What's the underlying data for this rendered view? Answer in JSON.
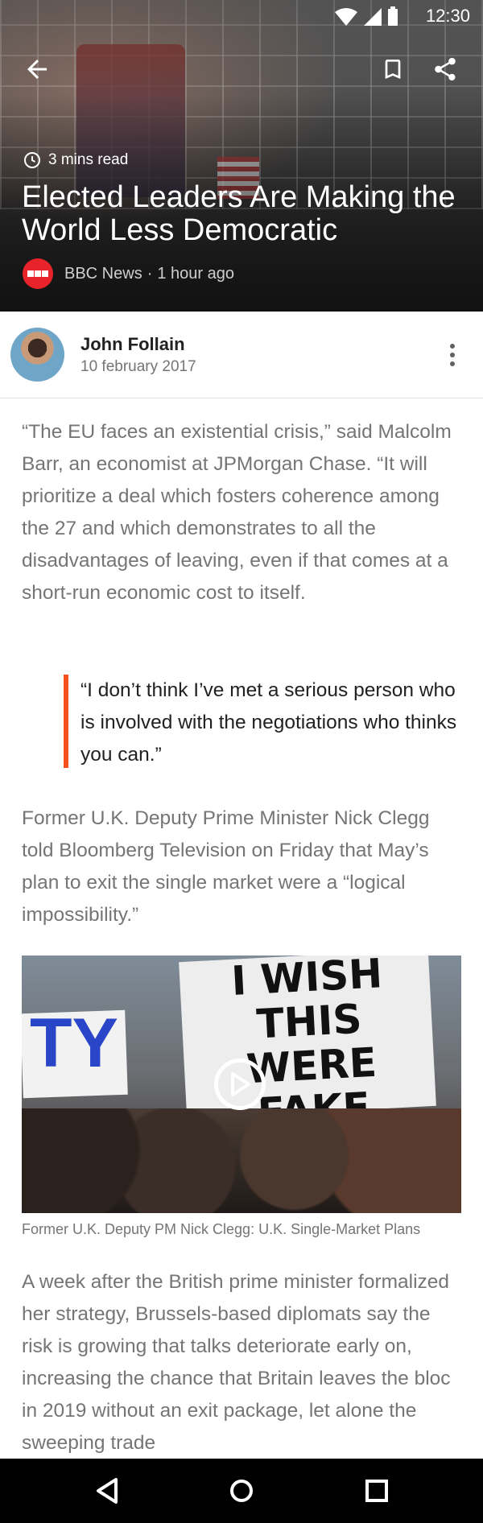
{
  "status_bar": {
    "time": "12:30"
  },
  "article": {
    "read_time": "3 mins read",
    "title": "Elected Leaders Are Making the World Less Democratic",
    "source": {
      "name": "BBC News",
      "separator": "·",
      "time_ago": "1 hour ago"
    }
  },
  "author": {
    "name": "John Follain",
    "date": "10 february 2017"
  },
  "body": {
    "paragraph_1": "“The EU faces an existential crisis,” said Malcolm Barr, an economist at JPMorgan Chase. “It will prioritize a deal which fosters coherence among the 27 and which demonstrates to all the disadvantages of leaving, even if that comes at a short-run economic cost to itself.",
    "quote": "“I don’t think I’ve met a serious person who is involved with the negotiations who thinks you can.”",
    "paragraph_2": "Former U.K. Deputy Prime Minister Nick Clegg told Bloomberg Television on Friday that May’s plan to exit the single market were a “logical impossibility.”",
    "video": {
      "sign_text": "I WISH THIS WERE FAKE NEWS",
      "left_sign_text": "TY",
      "caption": "Former U.K. Deputy PM Nick Clegg: U.K. Single-Market Plans"
    },
    "paragraph_3": "A week after the British prime minister formalized her strategy, Brussels-based diplomats say the risk is growing that talks deteriorate early on, increasing the chance that Britain leaves the bloc in 2019 without an exit package, let alone the sweeping trade"
  },
  "colors": {
    "accent": "#f4511e",
    "bbc_red": "#e8232a",
    "body_text": "#757575",
    "nav_bg": "#000000"
  },
  "icons": [
    "wifi-icon",
    "cell-signal-icon",
    "battery-icon",
    "back-arrow-icon",
    "bookmark-icon",
    "share-icon",
    "clock-icon",
    "more-vert-icon",
    "play-icon",
    "nav-back-icon",
    "nav-home-icon",
    "nav-recent-icon"
  ]
}
